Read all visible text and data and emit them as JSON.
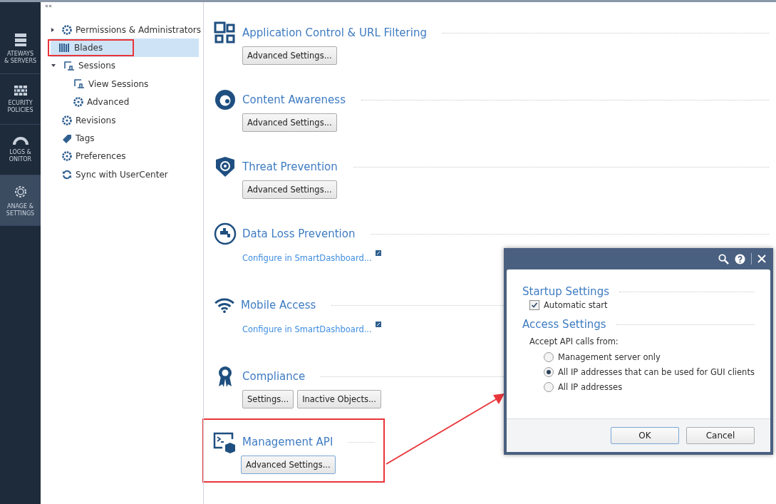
{
  "nav": [
    {
      "kind": "servers",
      "lines": [
        "ATEWAYS",
        "& SERVERS"
      ],
      "selected": false
    },
    {
      "kind": "firewall",
      "lines": [
        "ECURITY",
        "POLICIES"
      ],
      "selected": false
    },
    {
      "kind": "gauge",
      "lines": [
        "LOGS &",
        "ONITOR"
      ],
      "selected": false
    },
    {
      "kind": "gear",
      "lines": [
        "ANAGE &",
        "SETTINGS"
      ],
      "selected": true
    }
  ],
  "collapse_glyph": "««",
  "tree": [
    {
      "kind": "gear",
      "label": "Permissions & Administrators",
      "expanded": false,
      "selected": false,
      "highlighted": false
    },
    {
      "kind": "blades",
      "label": "Blades",
      "selected": true,
      "highlighted": true
    },
    {
      "kind": "sessions",
      "label": "Sessions",
      "expanded": true,
      "selected": false,
      "highlighted": false,
      "children": [
        {
          "kind": "sessions",
          "label": "View Sessions",
          "selected": false,
          "highlighted": false
        },
        {
          "kind": "gear",
          "label": "Advanced",
          "selected": false,
          "highlighted": false
        }
      ]
    },
    {
      "kind": "gear",
      "label": "Revisions",
      "selected": false,
      "highlighted": false
    },
    {
      "kind": "tag",
      "label": "Tags",
      "selected": false,
      "highlighted": false
    },
    {
      "kind": "gear",
      "label": "Preferences",
      "selected": false,
      "highlighted": false
    },
    {
      "kind": "sync",
      "label": "Sync with UserCenter",
      "selected": false,
      "highlighted": false
    }
  ],
  "sections": [
    {
      "kind": "apps",
      "title": "Application Control & URL Filtering",
      "highlighted": false,
      "actions": [
        {
          "kind": "button",
          "label": "Advanced Settings..."
        }
      ]
    },
    {
      "kind": "eye",
      "title": "Content Awareness",
      "highlighted": false,
      "actions": [
        {
          "kind": "button",
          "label": "Advanced Settings..."
        }
      ]
    },
    {
      "kind": "shield",
      "title": "Threat Prevention",
      "highlighted": false,
      "actions": [
        {
          "kind": "button",
          "label": "Advanced Settings..."
        }
      ]
    },
    {
      "kind": "faucet",
      "title": "Data Loss Prevention",
      "highlighted": false,
      "actions": [
        {
          "kind": "link",
          "label": "Configure in SmartDashboard..."
        }
      ]
    },
    {
      "kind": "wifi",
      "title": "Mobile Access",
      "highlighted": false,
      "actions": [
        {
          "kind": "link",
          "label": "Configure in SmartDashboard..."
        }
      ]
    },
    {
      "kind": "ribbon",
      "title": "Compliance",
      "highlighted": false,
      "actions": [
        {
          "kind": "button",
          "label": "Settings..."
        },
        {
          "kind": "button",
          "label": "Inactive Objects..."
        }
      ]
    },
    {
      "kind": "terminal",
      "title": "Management API",
      "highlighted": true,
      "actions": [
        {
          "kind": "button",
          "label": "Advanced Settings..."
        }
      ]
    }
  ],
  "dialog": {
    "groups": [
      {
        "title": "Startup Settings",
        "kind": "checkbox",
        "items": [
          {
            "label": "Automatic start",
            "checked": true
          }
        ]
      },
      {
        "title": "Access Settings",
        "kind": "radio",
        "caption": "Accept API calls from:",
        "items": [
          {
            "label": "Management server only",
            "selected": false
          },
          {
            "label": "All IP addresses that can be used for GUI clients",
            "selected": true
          },
          {
            "label": "All IP addresses",
            "selected": false
          }
        ]
      }
    ],
    "buttons": [
      {
        "label": "OK",
        "default": true
      },
      {
        "label": "Cancel",
        "default": false
      }
    ]
  }
}
